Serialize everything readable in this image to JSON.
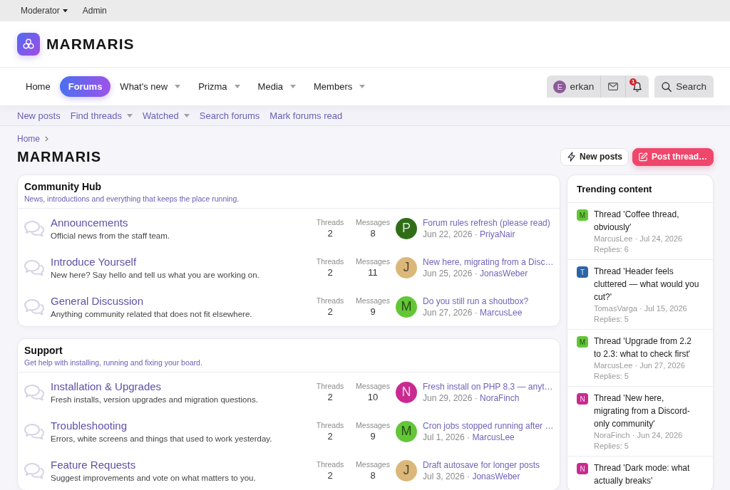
{
  "top_bar": [
    {
      "label": "Moderator",
      "has_menu": true
    },
    {
      "label": "Admin",
      "has_menu": false
    }
  ],
  "header": {
    "site_name": "MARMARIS"
  },
  "nav": {
    "tabs": [
      {
        "label": "Home",
        "selected": false,
        "has_menu": false
      },
      {
        "label": "Forums",
        "selected": true,
        "has_menu": false
      },
      {
        "label": "What's new",
        "selected": false,
        "has_menu": true
      },
      {
        "label": "Prizma",
        "selected": false,
        "has_menu": true
      },
      {
        "label": "Media",
        "selected": false,
        "has_menu": true
      },
      {
        "label": "Members",
        "selected": false,
        "has_menu": true
      }
    ],
    "account": {
      "initial": "E",
      "color": "#8d5a9b",
      "name": "erkan",
      "alerts_badge": "1"
    },
    "search": {
      "label": "Search"
    }
  },
  "sub_nav": [
    {
      "label": "New posts",
      "has_menu": false
    },
    {
      "label": "Find threads",
      "has_menu": true
    },
    {
      "label": "Watched",
      "has_menu": true
    },
    {
      "label": "Search forums",
      "has_menu": false
    },
    {
      "label": "Mark forums read",
      "has_menu": false
    }
  ],
  "breadcrumb": [
    {
      "label": "Home"
    }
  ],
  "page_title": "MARMARIS",
  "actions": [
    {
      "label": "New posts",
      "kind": "secondary"
    },
    {
      "label": "Post thread…",
      "kind": "primary"
    }
  ],
  "categories": [
    {
      "title": "Community Hub",
      "description": "News, introductions and everything that keeps the place running.",
      "forums": [
        {
          "title": "Announcements",
          "description": "Official news from the staff team.",
          "stats": [
            {
              "label": "Threads",
              "value": "2"
            },
            {
              "label": "Messages",
              "value": "8"
            }
          ],
          "last_post": {
            "initial": "P",
            "color": "#2f6e17",
            "title": "Forum rules refresh (please read)",
            "date": "Jun 22, 2026 ·",
            "user": "PriyaNair"
          }
        },
        {
          "title": "Introduce Yourself",
          "description": "New here? Say hello and tell us what you are working on.",
          "stats": [
            {
              "label": "Threads",
              "value": "2"
            },
            {
              "label": "Messages",
              "value": "11"
            }
          ],
          "last_post": {
            "initial": "J",
            "color": "#dbb77a",
            "title": "New here, migrating from a Disc…",
            "date": "Jun 25, 2026 ·",
            "user": "JonasWeber"
          }
        },
        {
          "title": "General Discussion",
          "description": "Anything community related that does not fit elsewhere.",
          "stats": [
            {
              "label": "Threads",
              "value": "2"
            },
            {
              "label": "Messages",
              "value": "9"
            }
          ],
          "last_post": {
            "initial": "M",
            "color": "#63c636",
            "title": "Do you still run a shoutbox?",
            "date": "Jun 27, 2026 ·",
            "user": "MarcusLee"
          }
        }
      ]
    },
    {
      "title": "Support",
      "description": "Get help with installing, running and fixing your board.",
      "forums": [
        {
          "title": "Installation & Upgrades",
          "description": "Fresh installs, version upgrades and migration questions.",
          "stats": [
            {
              "label": "Threads",
              "value": "2"
            },
            {
              "label": "Messages",
              "value": "10"
            }
          ],
          "last_post": {
            "initial": "N",
            "color": "#c92a8f",
            "title": "Fresh install on PHP 8.3 — anyt…",
            "date": "Jun 29, 2026 ·",
            "user": "NoraFinch"
          }
        },
        {
          "title": "Troubleshooting",
          "description": "Errors, white screens and things that used to work yesterday.",
          "stats": [
            {
              "label": "Threads",
              "value": "2"
            },
            {
              "label": "Messages",
              "value": "9"
            }
          ],
          "last_post": {
            "initial": "M",
            "color": "#63c636",
            "title": "Cron jobs stopped running after …",
            "date": "Jul 1, 2026 ·",
            "user": "MarcusLee"
          }
        },
        {
          "title": "Feature Requests",
          "description": "Suggest improvements and vote on what matters to you.",
          "stats": [
            {
              "label": "Threads",
              "value": "2"
            },
            {
              "label": "Messages",
              "value": "8"
            }
          ],
          "last_post": {
            "initial": "J",
            "color": "#dbb77a",
            "title": "Draft autosave for longer posts",
            "date": "Jul 3, 2026 ·",
            "user": "JonasWeber"
          }
        }
      ]
    }
  ],
  "sidebar": {
    "title": "Trending content",
    "items": [
      {
        "initial": "M",
        "color": "#63c636",
        "title": "Thread 'Coffee thread, obviously'",
        "meta": "MarcusLee · Jul 24, 2026",
        "replies": "Replies: 6"
      },
      {
        "initial": "T",
        "color": "#2c64a6",
        "title": "Thread 'Header feels cluttered — what would you cut?'",
        "meta": "TomasVarga · Jul 15, 2026",
        "replies": "Replies: 5"
      },
      {
        "initial": "M",
        "color": "#63c636",
        "title": "Thread 'Upgrade from 2.2 to 2.3: what to check first'",
        "meta": "MarcusLee · Jun 27, 2026",
        "replies": "Replies: 5"
      },
      {
        "initial": "N",
        "color": "#c92a8f",
        "title": "Thread 'New here, migrating from a Discord-only community'",
        "meta": "NoraFinch · Jun 24, 2026",
        "replies": "Replies: 5"
      },
      {
        "initial": "N",
        "color": "#c92a8f",
        "title": "Thread 'Dark mode: what actually breaks'"
      }
    ]
  }
}
